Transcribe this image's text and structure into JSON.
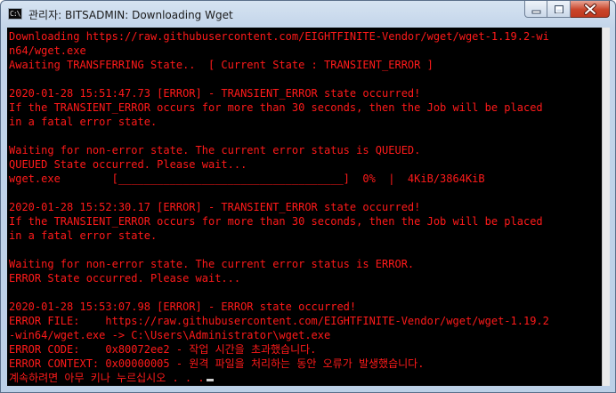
{
  "window": {
    "title": "관리자:  BITSADMIN: Downloading Wget",
    "icon_label": "C:\\",
    "icons": [
      "console-icon",
      "minimize-icon",
      "maximize-icon",
      "close-icon"
    ]
  },
  "colors": {
    "console_background": "#000000",
    "console_text": "#ff1a1a",
    "title_bar": "#c3d5ea",
    "close_button": "#c9452a"
  },
  "console": {
    "lines": [
      "Downloading https://raw.githubusercontent.com/EIGHTFINITE-Vendor/wget/wget-1.19.2-wi",
      "n64/wget.exe",
      "Awaiting TRANSFERRING State..  [ Current State : TRANSIENT_ERROR ]",
      "",
      "2020-01-28 15:51:47.73 [ERROR] - TRANSIENT_ERROR state occurred!",
      "If the TRANSIENT_ERROR occurs for more than 30 seconds, then the Job will be placed",
      "in a fatal error state.",
      "",
      "Waiting for non-error state. The current error status is QUEUED.",
      "QUEUED State occurred. Please wait...",
      "wget.exe        [___________________________________]  0%  |  4KiB/3864KiB",
      "",
      "2020-01-28 15:52:30.17 [ERROR] - TRANSIENT_ERROR state occurred!",
      "If the TRANSIENT_ERROR occurs for more than 30 seconds, then the Job will be placed",
      "in a fatal error state.",
      "",
      "Waiting for non-error state. The current error status is ERROR.",
      "ERROR State occurred. Please wait...",
      "",
      "2020-01-28 15:53:07.98 [ERROR] - ERROR state occurred!",
      "ERROR FILE:    https://raw.githubusercontent.com/EIGHTFINITE-Vendor/wget/wget-1.19.2",
      "-win64/wget.exe -> C:\\Users\\Administrator\\wget.exe",
      "ERROR CODE:    0x80072ee2 - 작업 시간을 초과했습니다.",
      "ERROR CONTEXT: 0x00000005 - 원격 파일을 처리하는 동안 오류가 발생했습니다.",
      "계속하려면 아무 키나 누르십시오 . . ."
    ]
  }
}
